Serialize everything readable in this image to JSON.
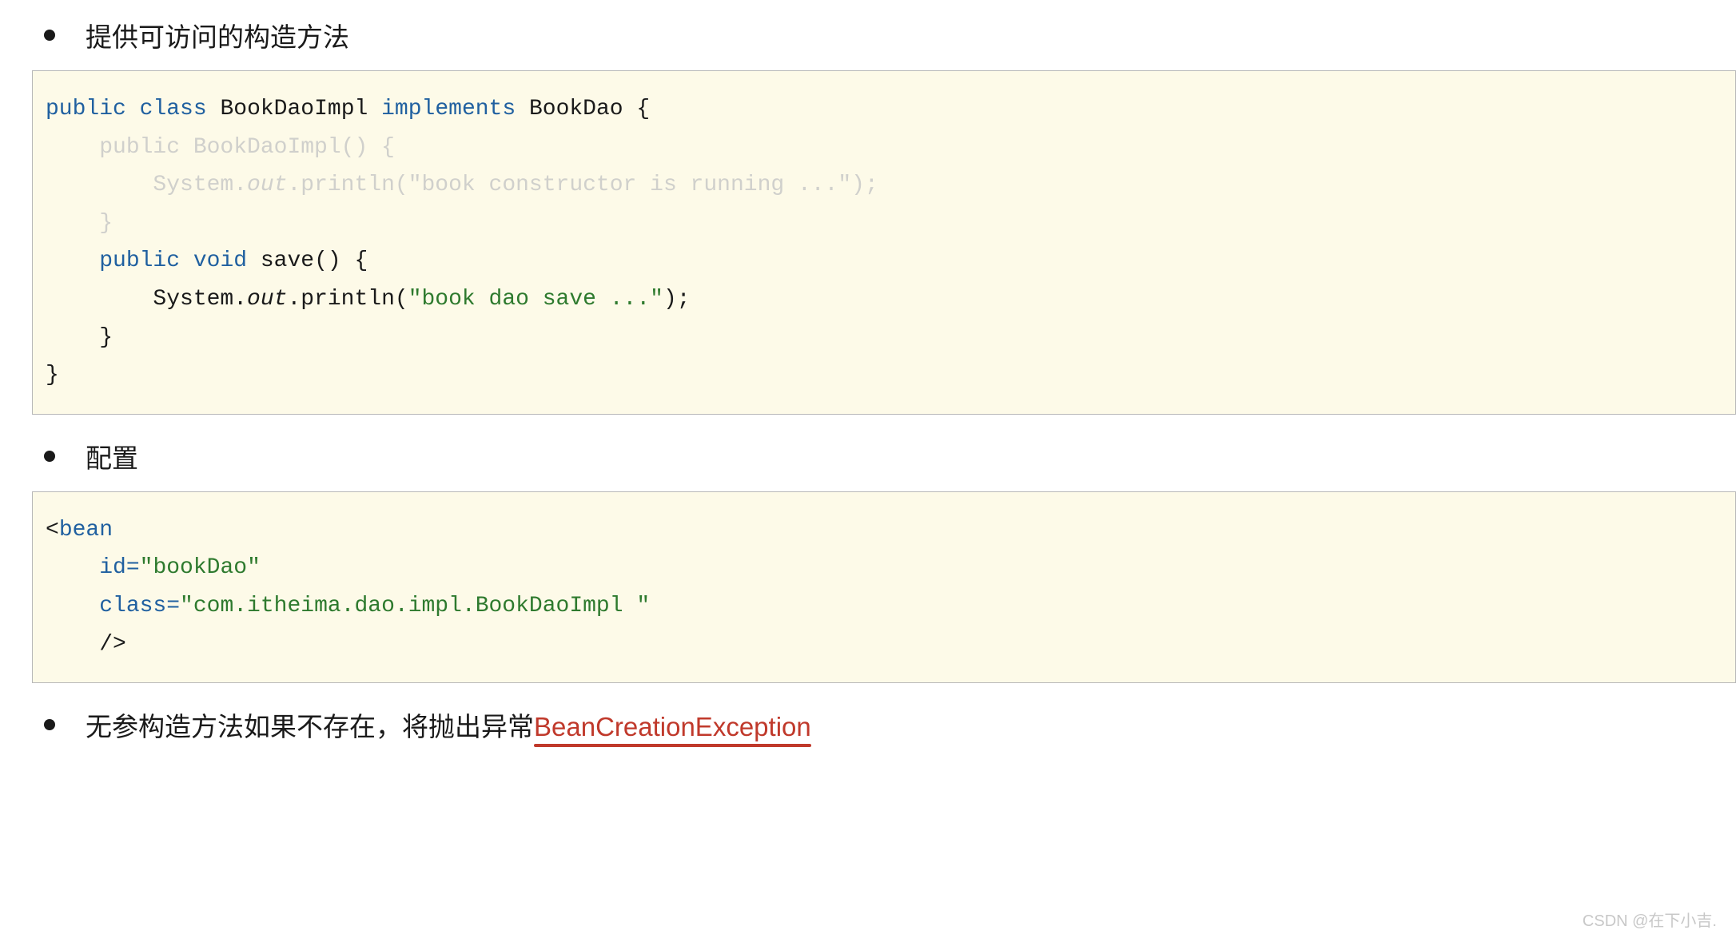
{
  "bullets": {
    "b1": "提供可访问的构造方法",
    "b2": "配置",
    "b3_prefix": "无参构造方法如果不存在，将抛出异常",
    "b3_exception": "BeanCreationException"
  },
  "code1": {
    "kw_public": "public",
    "kw_class": "class",
    "classname": "BookDaoImpl",
    "kw_implements": "implements",
    "iface": "BookDao",
    "brace_open": "{",
    "ctor_line1": "    public BookDaoImpl() {",
    "ctor_sys": "        System.",
    "ctor_out": "out",
    "ctor_tail": ".println(\"book constructor is running ...\");",
    "ctor_close": "    }",
    "save_kw_public": "    public",
    "save_kw_void": "void",
    "save_name": "save()",
    "save_brace": "{",
    "save_sys": "        System.",
    "save_out": "out",
    "save_print": ".println(",
    "save_str": "\"book dao save ...\"",
    "save_end": ");",
    "save_close": "    }",
    "brace_close": "}"
  },
  "code2": {
    "lt": "<",
    "bean": "bean",
    "id_attr": "    id=",
    "id_val_open": "\"",
    "id_val": "bookDao",
    "id_val_close": "\"",
    "class_attr": "    class=",
    "class_val_open": "\"",
    "class_val": "com.itheima.dao.impl.BookDaoImpl ",
    "class_val_close": "\"",
    "close": "    />"
  },
  "watermark": "CSDN @在下小吉."
}
